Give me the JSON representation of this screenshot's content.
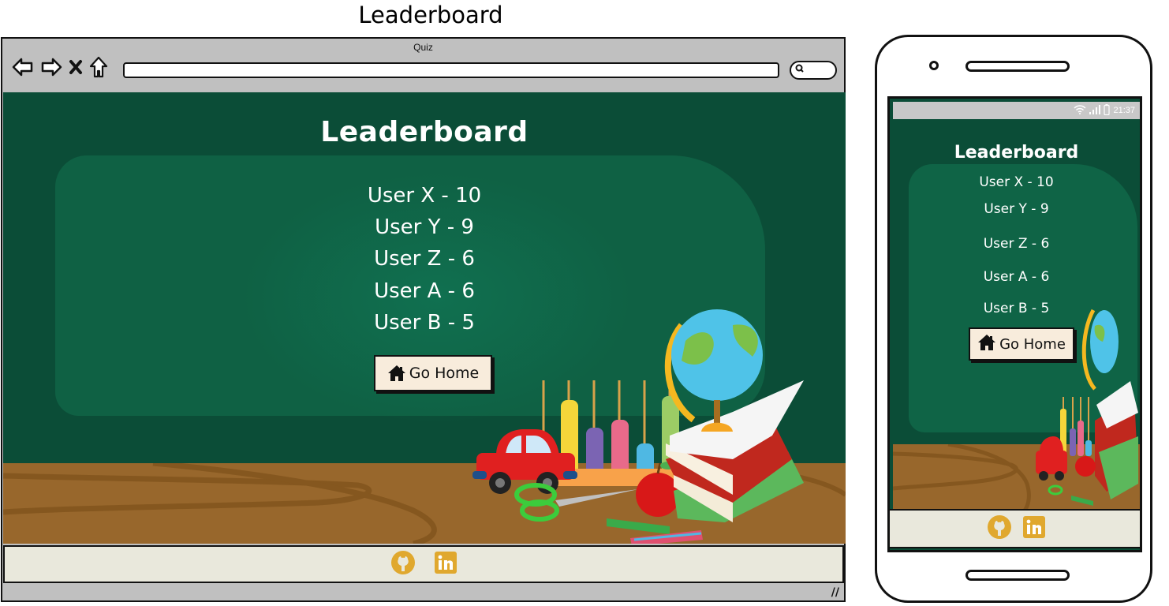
{
  "page": {
    "title": "Leaderboard"
  },
  "browser": {
    "window_title": "Quiz",
    "url": "",
    "nav_icons": [
      "back-arrow-icon",
      "forward-arrow-icon",
      "close-x-icon",
      "home-icon"
    ],
    "search_icon": "search-icon"
  },
  "leaderboard": {
    "heading": "Leaderboard",
    "entries": [
      {
        "label": "User X - 10",
        "user": "User X",
        "score": 10
      },
      {
        "label": "User Y - 9",
        "user": "User Y",
        "score": 9
      },
      {
        "label": "User Z - 6",
        "user": "User Z",
        "score": 6
      },
      {
        "label": "User A - 6",
        "user": "User A",
        "score": 6
      },
      {
        "label": "User B - 5",
        "user": "User B",
        "score": 5
      }
    ],
    "go_home_label": "Go Home"
  },
  "footer": {
    "links": [
      {
        "name": "github",
        "icon": "github-icon"
      },
      {
        "name": "linkedin",
        "icon": "linkedin-icon"
      }
    ],
    "icon_color": "#e0a82e"
  },
  "phone": {
    "status_time": "21:37",
    "status_icons": [
      "wifi-icon",
      "signal-icon",
      "battery-icon"
    ]
  },
  "colors": {
    "chalkboard": "#0b4d37",
    "chalk_smudge": "#0f6446",
    "desk": "#98672c",
    "button_bg": "#f8ecdc",
    "footer_bg": "#e9e8dc",
    "browser_chrome": "#c0c0c0"
  }
}
